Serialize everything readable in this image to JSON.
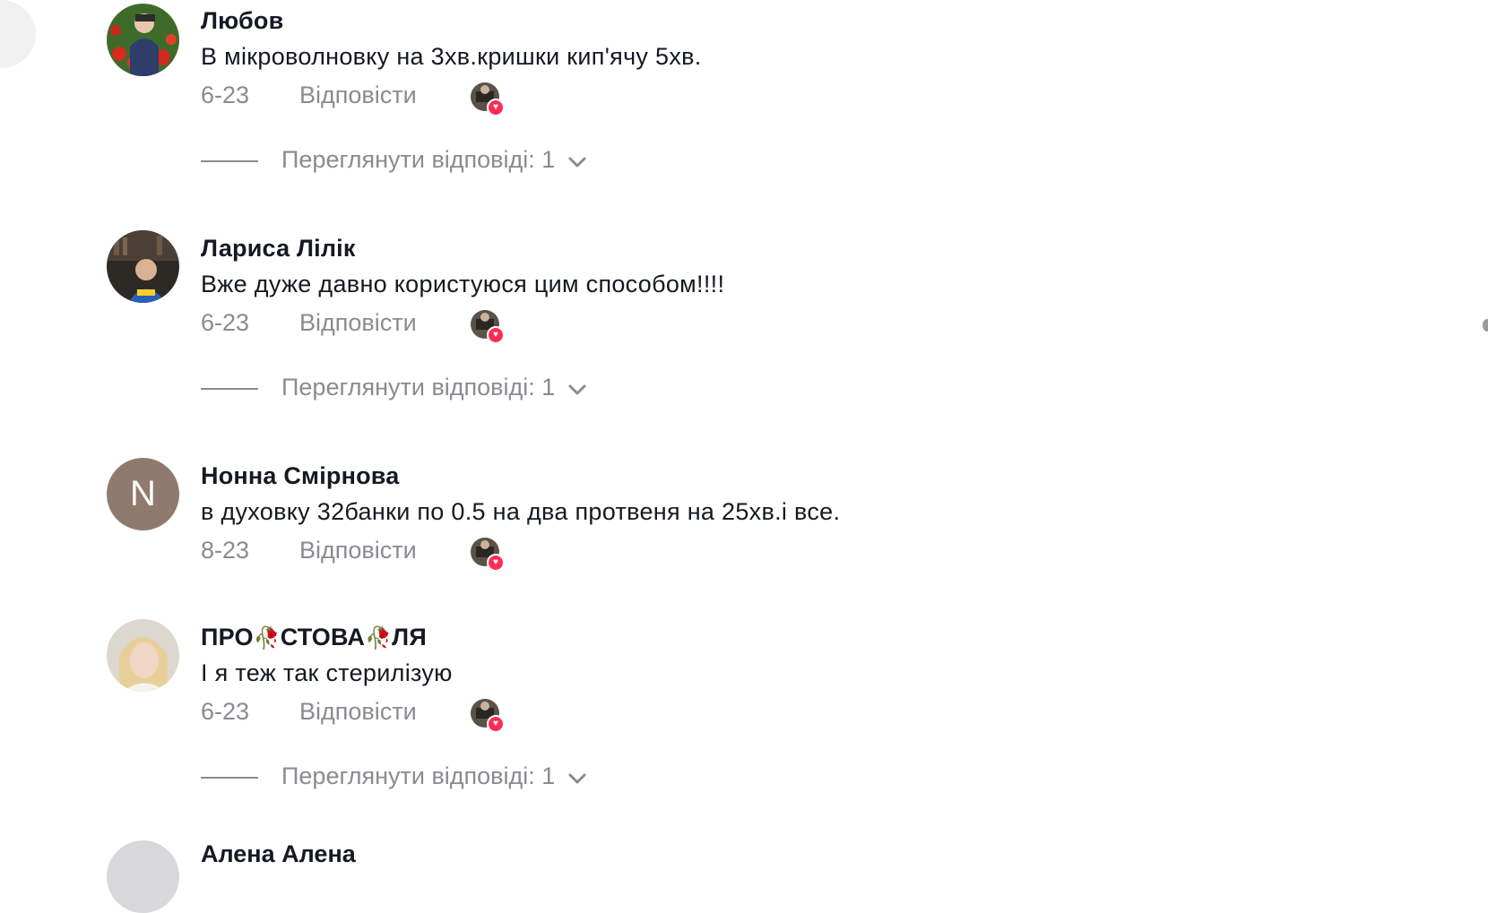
{
  "comments": [
    {
      "username": "Любов",
      "text": "В мікроволновку на 3хв.кришки кип'ячу 5хв.",
      "date": "6-23",
      "reply_label": "Відповісти",
      "view_replies": "Переглянути відповіді: 1"
    },
    {
      "username": "Лариса Лілік",
      "text": "Вже дуже давно користуюся цим способом!!!!",
      "date": "6-23",
      "reply_label": "Відповісти",
      "view_replies": "Переглянути відповіді: 1"
    },
    {
      "username": "Нонна Смірнова",
      "avatar_letter": "N",
      "text": "в духовку 32банки по 0.5 на два протвеня на 25хв.і все.",
      "date": "8-23",
      "reply_label": "Відповісти"
    },
    {
      "username_parts": [
        "ПРО",
        "🥀",
        "СТОВА",
        "🥀",
        "ЛЯ"
      ],
      "text": "І я теж так стерилізую",
      "date": "6-23",
      "reply_label": "Відповісти",
      "view_replies": "Переглянути відповіді: 1"
    },
    {
      "username": "Алена Алена"
    }
  ],
  "icons": {
    "liked_by_creator": "creator-avatar-with-heart-icon",
    "expand": "chevron-down-icon"
  },
  "colors": {
    "text": "#161823",
    "muted": "#8a8b91",
    "heart": "#fe2c55",
    "letter_avatar": "#8f7a6e"
  }
}
